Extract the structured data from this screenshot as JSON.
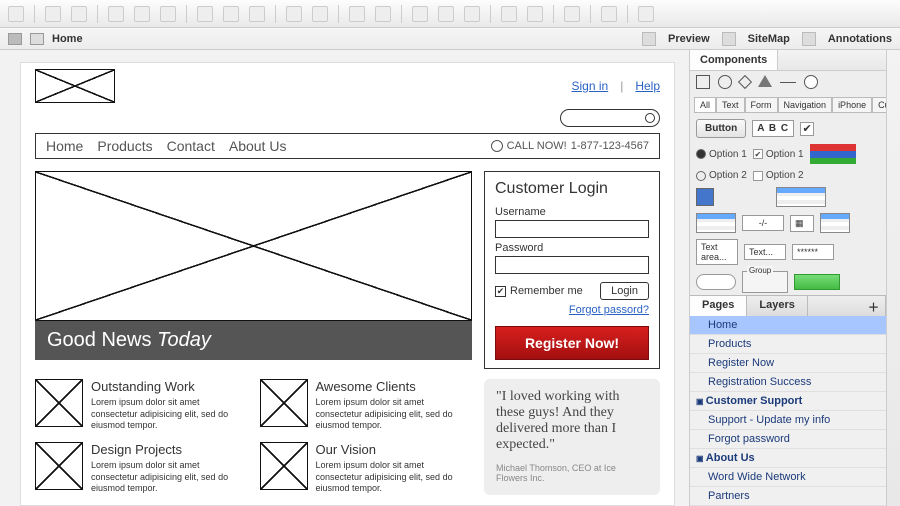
{
  "breadcrumb": {
    "home": "Home"
  },
  "bc_actions": {
    "preview": "Preview",
    "sitemap": "SiteMap",
    "annotations": "Annotations"
  },
  "panels": {
    "components_tab": "Components",
    "pages_tab": "Pages",
    "layers_tab": "Layers",
    "filters": {
      "all": "All",
      "text": "Text",
      "form": "Form",
      "nav": "Navigation",
      "iphone": "iPhone",
      "custom": "Custom"
    },
    "items": {
      "button": "Button",
      "abc": "A B C",
      "option1": "Option 1",
      "option2": "Option 2",
      "textarea": "Text area...",
      "textfield": "Text...",
      "pwd": "******",
      "group": "Group"
    }
  },
  "pages": {
    "home": "Home",
    "products": "Products",
    "register_now": "Register Now",
    "reg_success": "Registration Success",
    "group_support": "Customer Support",
    "support_update": "Support - Update my info",
    "forgot_pwd": "Forgot password",
    "group_about": "About Us",
    "wwn": "Word Wide Network",
    "partners": "Partners"
  },
  "wf": {
    "signin": "Sign in",
    "help": "Help",
    "nav": {
      "home": "Home",
      "products": "Products",
      "contact": "Contact",
      "about": "About Us"
    },
    "call_label": "CALL NOW!",
    "call_num": "1-877-123-4567",
    "hero_prefix": "Good News ",
    "hero_em": "Today",
    "login": {
      "title": "Customer Login",
      "username": "Username",
      "password": "Password",
      "remember": "Remember me",
      "login_btn": "Login",
      "forgot": "Forgot passord?",
      "register": "Register Now!"
    },
    "feat": {
      "t1": "Outstanding Work",
      "t2": "Awesome Clients",
      "t3": "Design Projects",
      "t4": "Our Vision",
      "lorem": "Lorem ipsum dolor sit amet consectetur adipisicing elit, sed do eiusmod tempor."
    },
    "quote": "\"I loved working with these guys! And they delivered more than I expected.\"",
    "quote_attr": "Michael Thomson, CEO at Ice Flowers Inc."
  }
}
